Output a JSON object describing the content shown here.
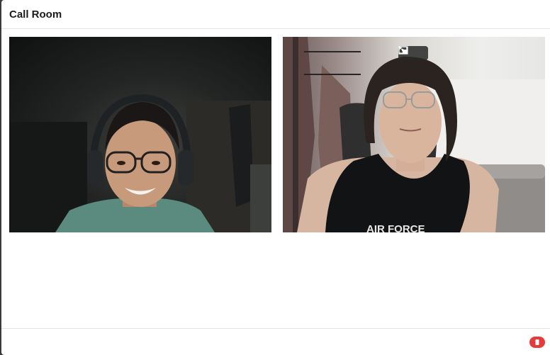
{
  "header": {
    "title": "Call Room"
  },
  "videos": [
    {
      "participant": "remote",
      "icon": "person-headphones-video"
    },
    {
      "participant": "local",
      "icon": "person-tanktop-video"
    }
  ],
  "overlay": {
    "icons": [
      "exit-fullscreen-icon",
      "picture-in-picture-icon"
    ]
  },
  "footer": {
    "end_call_icon": "phone-hangup-icon",
    "end_call_color": "#e63b3b"
  },
  "colors": {
    "background": "#ffffff",
    "divider": "#e4e4e4",
    "title": "#1b1b1b"
  }
}
